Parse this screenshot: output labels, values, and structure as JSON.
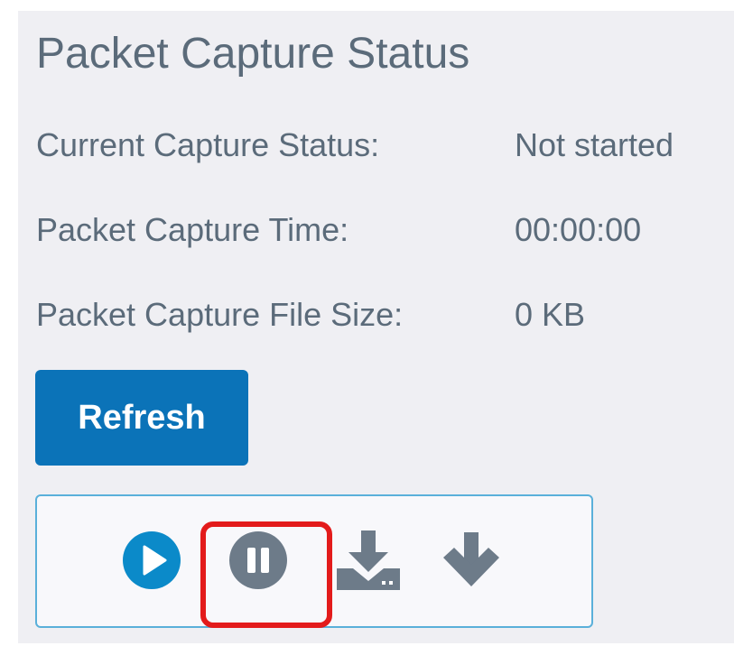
{
  "status": {
    "title": "Packet Capture Status",
    "rows": [
      {
        "label": "Current Capture Status:",
        "value": "Not started"
      },
      {
        "label": "Packet Capture Time:",
        "value": "00:00:00"
      },
      {
        "label": "Packet Capture File Size:",
        "value": "0 KB"
      }
    ]
  },
  "actions": {
    "refresh_label": "Refresh"
  },
  "toolbar": {
    "icons": [
      "play-icon",
      "pause-icon",
      "download-to-device-icon",
      "arrow-down-icon"
    ]
  },
  "colors": {
    "text": "#5b6b7a",
    "panel": "#efeff3",
    "primary": "#0b73b8",
    "play": "#0b8ac9",
    "icon_gray": "#6d7b89",
    "toolbar_border": "#5ab0da",
    "highlight": "#e31b1b"
  }
}
